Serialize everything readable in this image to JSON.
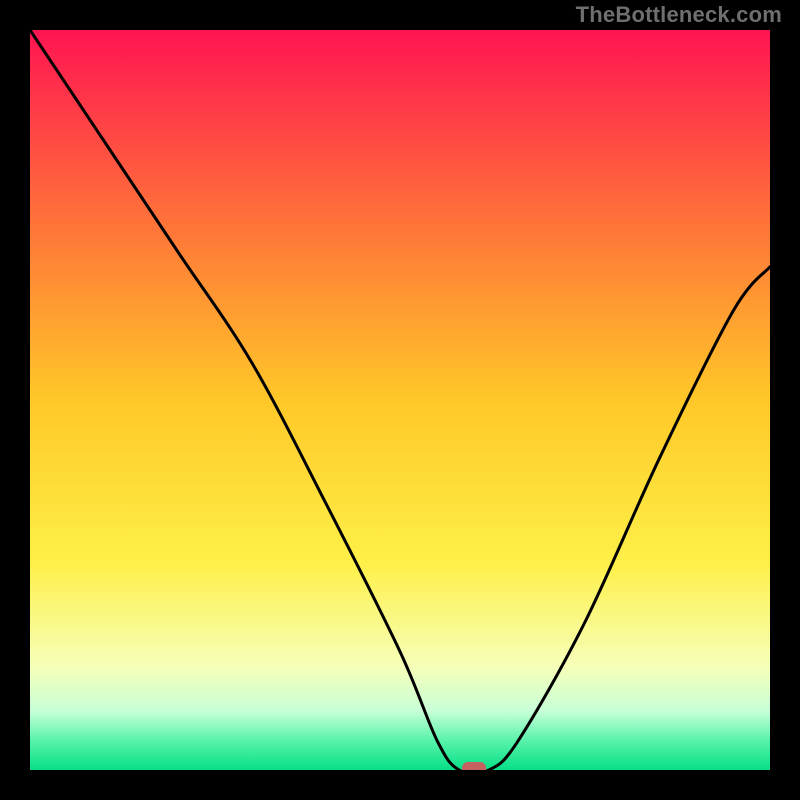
{
  "watermark": "TheBottleneck.com",
  "chart_data": {
    "type": "line",
    "title": "",
    "xlabel": "",
    "ylabel": "",
    "xlim": [
      0,
      100
    ],
    "ylim": [
      0,
      100
    ],
    "curve": [
      {
        "x": 0,
        "y": 100
      },
      {
        "x": 10,
        "y": 85
      },
      {
        "x": 20,
        "y": 70
      },
      {
        "x": 30,
        "y": 55
      },
      {
        "x": 40,
        "y": 36
      },
      {
        "x": 50,
        "y": 16
      },
      {
        "x": 55,
        "y": 4
      },
      {
        "x": 58,
        "y": 0
      },
      {
        "x": 62,
        "y": 0
      },
      {
        "x": 66,
        "y": 4
      },
      {
        "x": 75,
        "y": 20
      },
      {
        "x": 85,
        "y": 42
      },
      {
        "x": 95,
        "y": 62
      },
      {
        "x": 100,
        "y": 68
      }
    ],
    "marker": {
      "x": 60,
      "y": 0,
      "color": "#c56160"
    },
    "gradient_stops": [
      {
        "offset": 0.0,
        "color": "#ff1452"
      },
      {
        "offset": 0.25,
        "color": "#ff6f3a"
      },
      {
        "offset": 0.5,
        "color": "#ffc828"
      },
      {
        "offset": 0.72,
        "color": "#fef048"
      },
      {
        "offset": 0.86,
        "color": "#f6ffb9"
      },
      {
        "offset": 0.92,
        "color": "#c8ffd7"
      },
      {
        "offset": 0.96,
        "color": "#59f3ab"
      },
      {
        "offset": 1.0,
        "color": "#06df86"
      }
    ]
  }
}
